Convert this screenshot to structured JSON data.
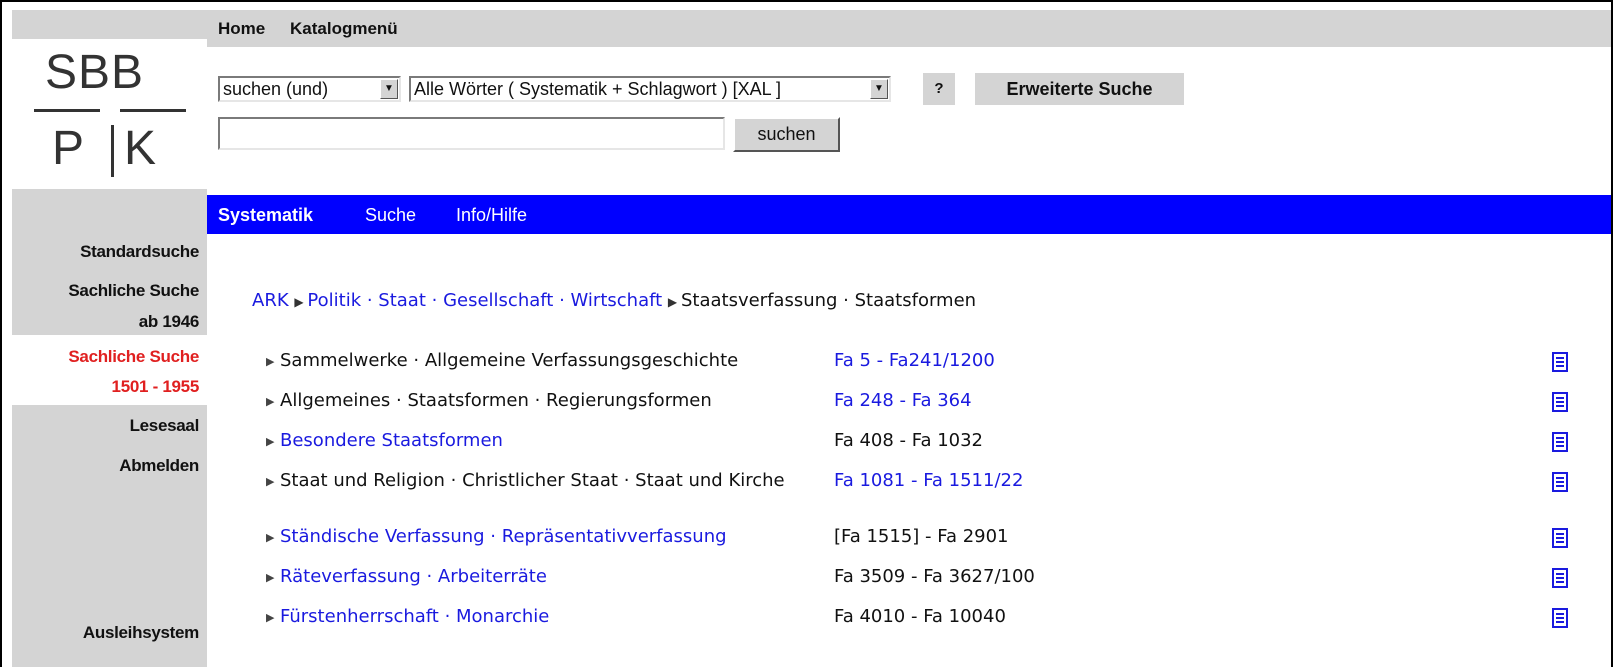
{
  "logo": {
    "top": "SBB",
    "bottom_left": "P",
    "bottom_right": "K"
  },
  "topnav": {
    "home": "Home",
    "catalog_menu": "Katalogmenü"
  },
  "search": {
    "mode_select": "suchen (und)",
    "field_select": "Alle Wörter ( Systematik + Schlagwort ) [XAL ]",
    "help_button": "?",
    "advanced_button": "Erweiterte Suche",
    "query_value": "",
    "submit_button": "suchen"
  },
  "tabs": {
    "current": "Systematik",
    "search": "Suche",
    "info": "Info/Hilfe"
  },
  "sidebar": {
    "standard": "Standardsuche",
    "sachlich_1946_a": "Sachliche Suche",
    "sachlich_1946_b": "ab 1946",
    "sachlich_1501_a": "Sachliche Suche",
    "sachlich_1501_b": "1501 - 1955",
    "lesesaal": "Lesesaal",
    "abmelden": "Abmelden",
    "ausleih": "Ausleihsystem"
  },
  "breadcrumb": {
    "root": "ARK",
    "politik": "Politik",
    "staat": "Staat",
    "gesellschaft": "Gesellschaft",
    "wirtschaft": "Wirtschaft",
    "staatsverfassung": "Staatsverfassung",
    "staatsformen": "Staatsformen",
    "dot": " · "
  },
  "rows": [
    {
      "title": "Sammelwerke · Allgemeine Verfassungsgeschichte",
      "range": "Fa 5 - Fa241/1200",
      "title_link": false,
      "range_link": true
    },
    {
      "title": "Allgemeines · Staatsformen · Regierungsformen",
      "range": "Fa 248 - Fa 364",
      "title_link": false,
      "range_link": true
    },
    {
      "title": "Besondere Staatsformen",
      "range": "Fa 408 - Fa 1032",
      "title_link": true,
      "range_link": false
    },
    {
      "title": "Staat und Religion · Christlicher Staat · Staat und Kirche",
      "range": "Fa 1081 - Fa 1511/22",
      "title_link": false,
      "range_link": true
    },
    {
      "title": "Ständische Verfassung · Repräsentativverfassung",
      "range": "[Fa 1515] - Fa 2901",
      "title_link": true,
      "range_link": false
    },
    {
      "title": "Räteverfassung · Arbeiterräte",
      "range": "Fa 3509 - Fa 3627/100",
      "title_link": true,
      "range_link": false
    },
    {
      "title": "Fürstenherrschaft · Monarchie",
      "range": "Fa 4010 - Fa 10040",
      "title_link": true,
      "range_link": false
    }
  ],
  "colors": {
    "nav_blue": "#0000ff",
    "link_blue": "#1a1adf",
    "active_red": "#e02020",
    "panel_gray": "#d4d4d4"
  },
  "icons": {
    "row_action": "document-list-icon",
    "dropdown": "dropdown-arrow-icon",
    "bullet": "triangle-right-icon"
  }
}
